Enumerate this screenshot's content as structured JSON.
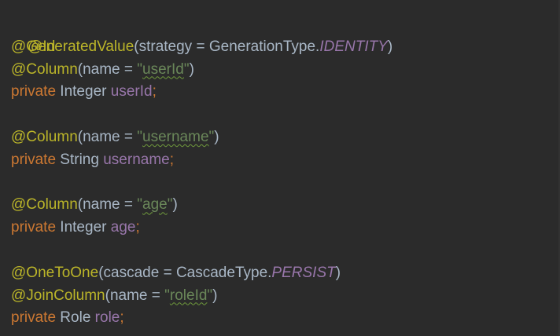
{
  "code": {
    "line1": {
      "annotation": "@Id"
    },
    "line2": {
      "annotation": "@GeneratedValue",
      "open": "(",
      "param": "strategy",
      "eq": " = ",
      "type": "GenerationType.",
      "constant": "IDENTITY",
      "close": ")"
    },
    "line3": {
      "annotation": "@Column",
      "open": "(",
      "param": "name",
      "eq": " = ",
      "quote_open": "\"",
      "value": "userId",
      "quote_close": "\"",
      "close": ")"
    },
    "line4": {
      "modifier": "private",
      "type": " Integer ",
      "field": "userId",
      "semicolon": ";"
    },
    "line6": {
      "annotation": "@Column",
      "open": "(",
      "param": "name",
      "eq": " = ",
      "quote_open": "\"",
      "value": "username",
      "quote_close": "\"",
      "close": ")"
    },
    "line7": {
      "modifier": "private",
      "type": " String ",
      "field": "username",
      "semicolon": ";"
    },
    "line9": {
      "annotation": "@Column",
      "open": "(",
      "param": "name",
      "eq": " = ",
      "quote_open": "\"",
      "value": "age",
      "quote_close": "\"",
      "close": ")"
    },
    "line10": {
      "modifier": "private",
      "type": " Integer ",
      "field": "age",
      "semicolon": ";"
    },
    "line12": {
      "annotation": "@OneToOne",
      "open": "(",
      "param": "cascade",
      "eq": " = ",
      "type": "CascadeType.",
      "constant": "PERSIST",
      "close": ")"
    },
    "line13": {
      "annotation": "@JoinColumn",
      "open": "(",
      "param": "name",
      "eq": " = ",
      "quote_open": "\"",
      "value": "roleId",
      "quote_close": "\"",
      "close": ")"
    },
    "line14": {
      "modifier": "private",
      "type": " Role ",
      "field": "role",
      "semicolon": ";"
    }
  },
  "colors": {
    "background": "#2b2b2b",
    "annotation": "#bbb529",
    "keyword": "#cc7832",
    "field": "#9876aa",
    "string": "#6a8759",
    "plain": "#a9b7c6",
    "spellcheck_underline": "#6f9a3c"
  }
}
